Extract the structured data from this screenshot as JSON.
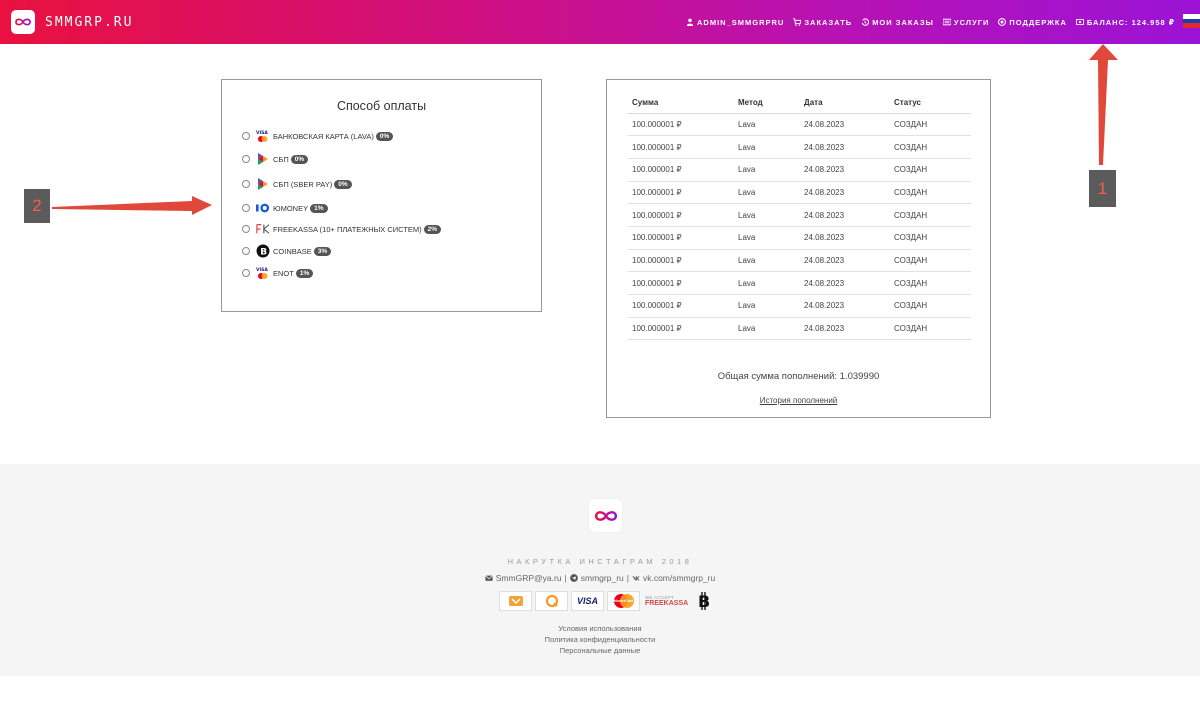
{
  "header": {
    "brand": "SMMGRP.RU",
    "nav": [
      {
        "label": "ADMIN_SMMGRPRU",
        "icon": "user-icon"
      },
      {
        "label": "ЗАКАЗАТЬ",
        "icon": "cart-icon"
      },
      {
        "label": "МОИ ЗАКАЗЫ",
        "icon": "history-icon"
      },
      {
        "label": "УСЛУГИ",
        "icon": "list-icon"
      },
      {
        "label": "ПОДДЕРЖКА",
        "icon": "support-icon"
      },
      {
        "label": "БАЛАНС: 124.958 ₽",
        "icon": "wallet-icon"
      }
    ],
    "flag_colors": [
      "#ffffff",
      "#1c3fa8",
      "#e0282e"
    ]
  },
  "payment": {
    "title": "Способ оплаты",
    "methods": [
      {
        "label": "БАНКОВСКАЯ КАРТА (LAVA)",
        "fee": "0%",
        "icon": "visa-mastercard-icon"
      },
      {
        "label": "СБП",
        "fee": "0%",
        "icon": "sbp-icon"
      },
      {
        "label": "СБП (SBER PAY)",
        "fee": "0%",
        "icon": "sbp-icon"
      },
      {
        "label": "ЮMONEY",
        "fee": "1%",
        "icon": "yoomoney-icon"
      },
      {
        "label": "FREEKASSA (10+ ПЛАТЕЖНЫХ СИСТЕМ)",
        "fee": "2%",
        "icon": "freekassa-icon"
      },
      {
        "label": "COINBASE",
        "fee": "3%",
        "icon": "bitcoin-icon"
      },
      {
        "label": "ENOT",
        "fee": "1%",
        "icon": "visa-mastercard-icon"
      }
    ]
  },
  "transactions": {
    "columns": [
      "Сумма",
      "Метод",
      "Дата",
      "Статус"
    ],
    "rows": [
      [
        "100.000001 ₽",
        "Lava",
        "24.08.2023",
        "СОЗДАН"
      ],
      [
        "100.000001 ₽",
        "Lava",
        "24.08.2023",
        "СОЗДАН"
      ],
      [
        "100.000001 ₽",
        "Lava",
        "24.08.2023",
        "СОЗДАН"
      ],
      [
        "100.000001 ₽",
        "Lava",
        "24.08.2023",
        "СОЗДАН"
      ],
      [
        "100.000001 ₽",
        "Lava",
        "24.08.2023",
        "СОЗДАН"
      ],
      [
        "100.000001 ₽",
        "Lava",
        "24.08.2023",
        "СОЗДАН"
      ],
      [
        "100.000001 ₽",
        "Lava",
        "24.08.2023",
        "СОЗДАН"
      ],
      [
        "100.000001 ₽",
        "Lava",
        "24.08.2023",
        "СОЗДАН"
      ],
      [
        "100.000001 ₽",
        "Lava",
        "24.08.2023",
        "СОЗДАН"
      ],
      [
        "100.000001 ₽",
        "Lava",
        "24.08.2023",
        "СОЗДАН"
      ]
    ],
    "total": "Общая сумма пополнений: 1.039990",
    "history_link": "История пополнений"
  },
  "annotations": {
    "marker_1": "1",
    "marker_2": "2",
    "color": "#e0483c"
  },
  "footer": {
    "tagline": "НАКРУТКА ИНСТАГРАМ 2018",
    "email": "SmmGRP@ya.ru",
    "telegram": "smmgrp_ru",
    "vk": "vk.com/smmgrp_ru",
    "separator": "|",
    "payment_badges": {
      "visa": "VISA",
      "mastercard": "MasterCard",
      "freekassa_top": "WE ACCEPT",
      "freekassa_bottom": "FREEKASSA"
    },
    "links": [
      "Условия использования",
      "Политика конфиденциальности",
      "Персональные данные"
    ]
  }
}
